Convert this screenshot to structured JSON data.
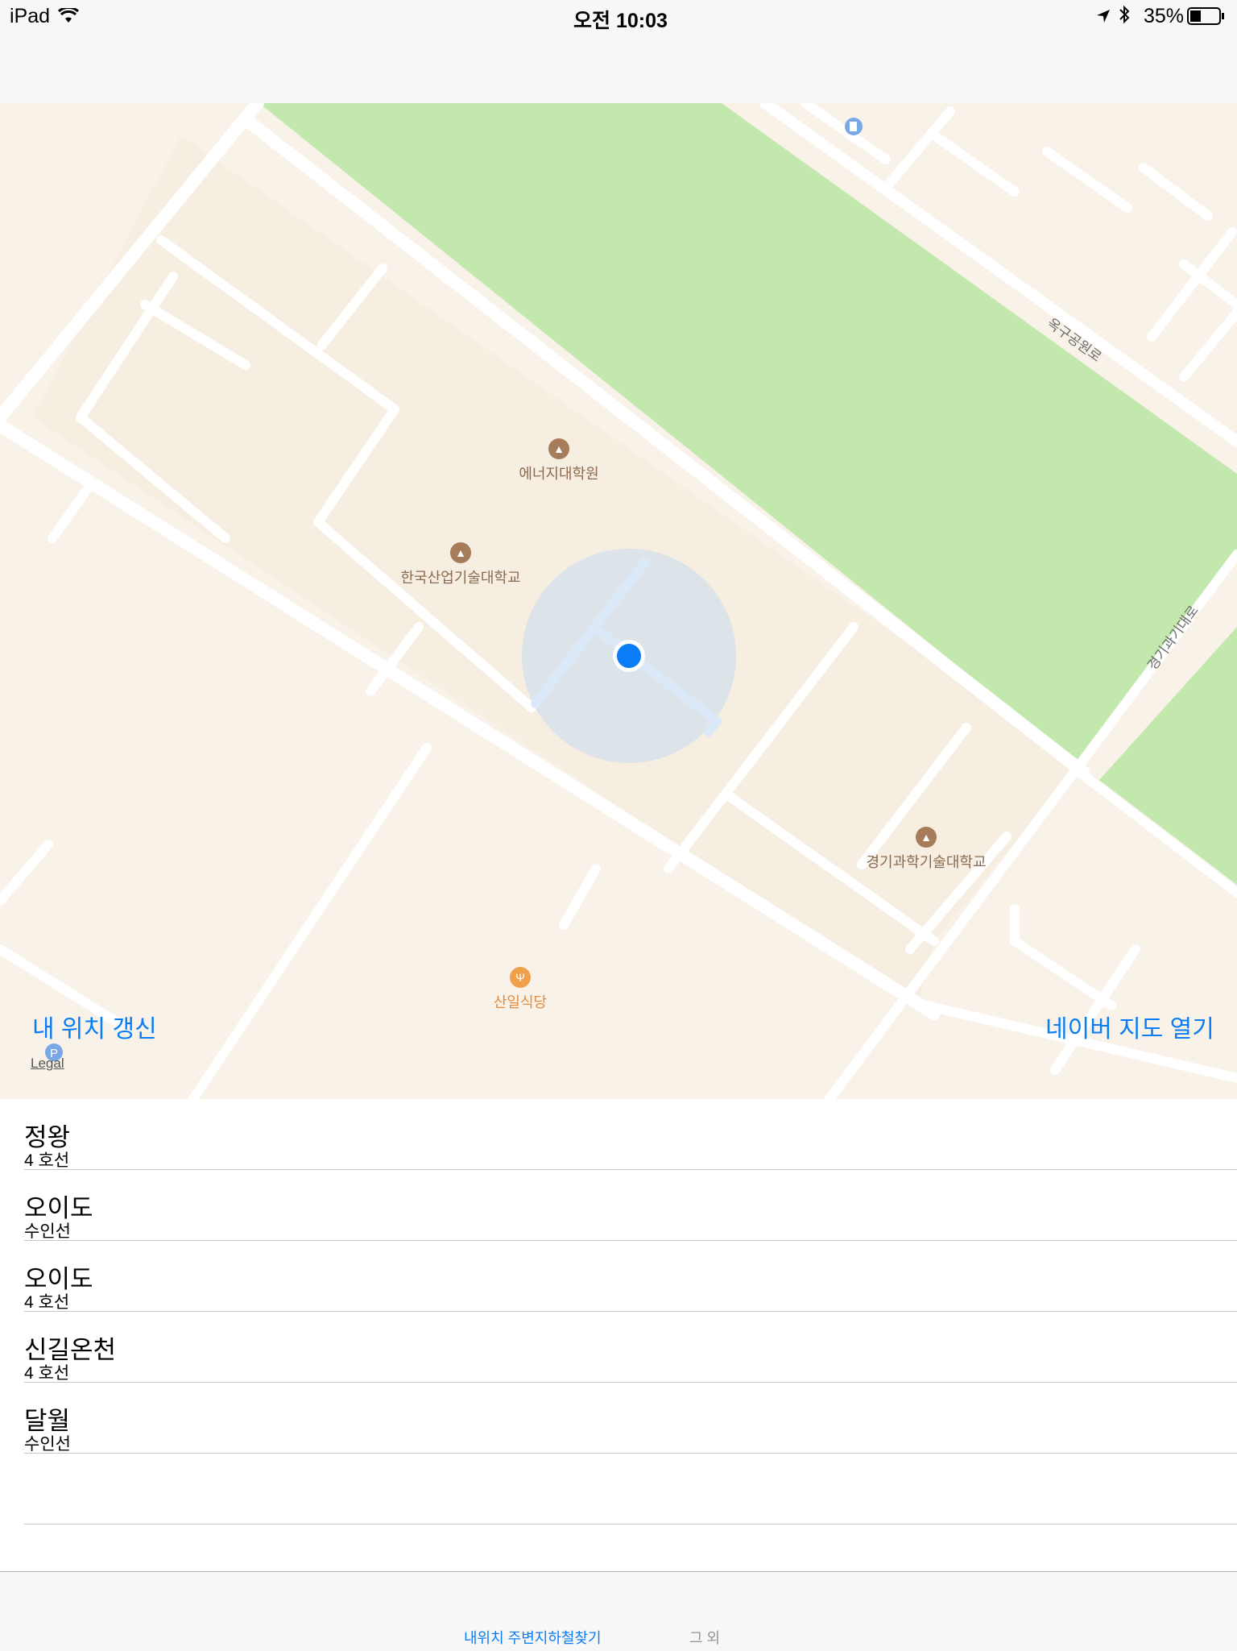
{
  "status_bar": {
    "device": "iPad",
    "time": "오전 10:03",
    "battery": "35%",
    "icons": [
      "wifi-icon",
      "location-arrow-icon",
      "bluetooth-icon",
      "battery-icon"
    ]
  },
  "map": {
    "pois": [
      {
        "name": "에너지대학원",
        "icon": "graduation-cap-icon"
      },
      {
        "name": "한국산업기술대학교",
        "icon": "graduation-cap-icon"
      },
      {
        "name": "경기과학기술대학교",
        "icon": "graduation-cap-icon"
      },
      {
        "name": "산일식당",
        "icon": "fork-knife-icon"
      }
    ],
    "roads": [
      "옥구공원로",
      "경기과기대로"
    ],
    "update_location": "내 위치 갱신",
    "open_naver": "네이버 지도 열기",
    "legal": "Legal",
    "colors": {
      "park": "#c3e8ae",
      "campus": "#f6eee0",
      "base": "#f8f2e9",
      "road": "#ffffff",
      "user": "#0a7cf6"
    }
  },
  "stations": [
    {
      "name": "정왕",
      "line": "4 호선"
    },
    {
      "name": "오이도",
      "line": "수인선"
    },
    {
      "name": "오이도",
      "line": "4 호선"
    },
    {
      "name": "신길온천",
      "line": "4 호선"
    },
    {
      "name": "달월",
      "line": "수인선"
    }
  ],
  "tabs": [
    {
      "label": "내위치 주변지하철찾기",
      "active": true
    },
    {
      "label": "그 외",
      "active": false
    }
  ]
}
